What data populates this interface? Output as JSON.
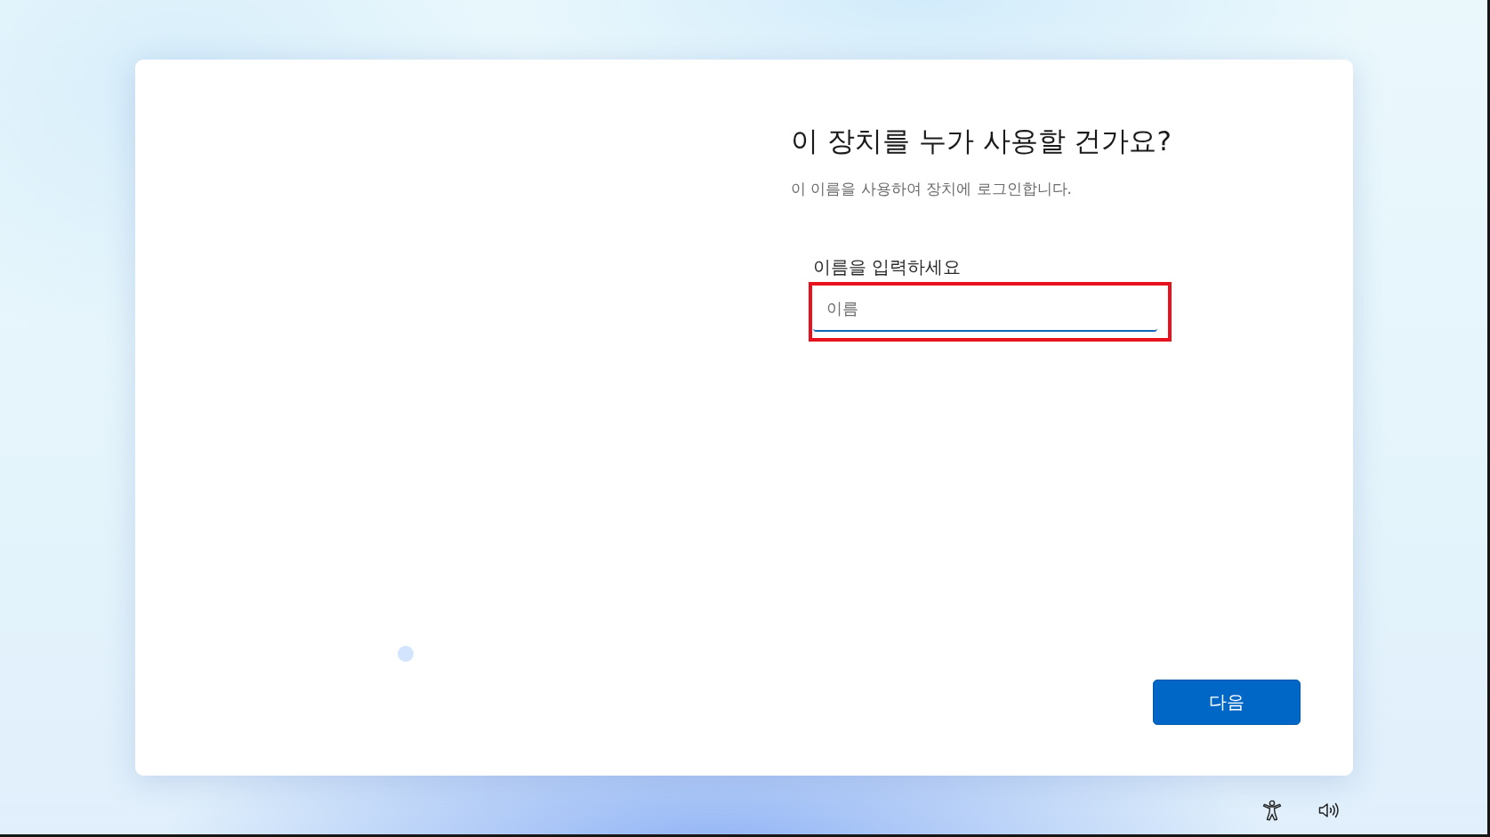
{
  "dialog": {
    "title": "이 장치를 누가 사용할 건가요?",
    "subtitle": "이 이름을 사용하여 장치에 로그인합니다."
  },
  "name_field": {
    "label": "이름을 입력하세요",
    "placeholder": "이름",
    "highlighted": true
  },
  "next_button": {
    "label": "다음"
  },
  "system_buttons": [
    {
      "kind": "accessibility"
    },
    {
      "kind": "volume"
    }
  ]
}
